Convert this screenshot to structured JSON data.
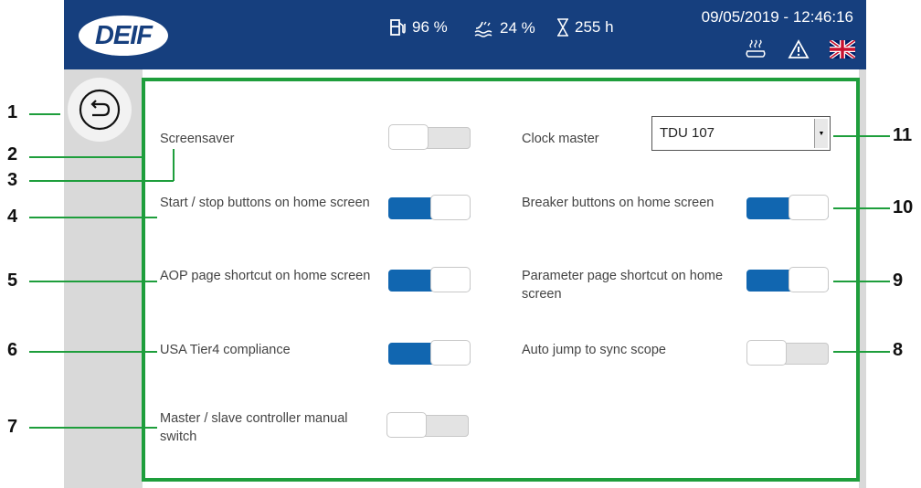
{
  "header": {
    "logo_text": "DEIF",
    "fuel": "96 %",
    "water": "24 %",
    "hours": "255 h",
    "datetime": "09/05/2019 - 12:46:16",
    "brand_color": "#163f7e"
  },
  "settings": {
    "screensaver": {
      "label": "Screensaver",
      "on": false
    },
    "start_stop": {
      "label": "Start / stop buttons on home screen",
      "on": true
    },
    "aop_shortcut": {
      "label": "AOP page shortcut on home screen",
      "on": true
    },
    "usa_tier4": {
      "label": "USA Tier4 compliance",
      "on": true
    },
    "master_slave": {
      "label": "Master / slave controller manual switch",
      "on": false
    },
    "clock_master": {
      "label": "Clock master",
      "value": "TDU 107"
    },
    "breaker_buttons": {
      "label": "Breaker buttons on home screen",
      "on": true
    },
    "parameter_shortcut": {
      "label": "Parameter page shortcut on home screen",
      "on": true
    },
    "auto_jump": {
      "label": "Auto jump to sync scope",
      "on": false
    }
  },
  "callouts": [
    "1",
    "2",
    "3",
    "4",
    "5",
    "6",
    "7",
    "8",
    "9",
    "10",
    "11"
  ],
  "colors": {
    "toggle_on": "#1166b0",
    "callout_line": "#1e9e3c"
  },
  "icons": [
    "fuel-icon",
    "water-icon",
    "hourglass-icon",
    "heater-icon",
    "warning-icon",
    "uk-flag-icon",
    "back-icon"
  ]
}
